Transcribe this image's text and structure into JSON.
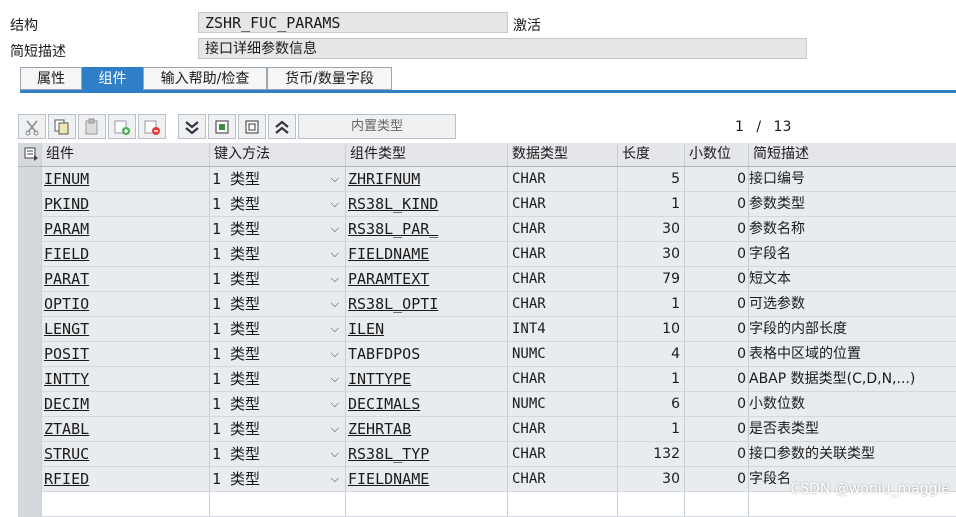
{
  "header": {
    "structure_label": "结构",
    "structure_value": "ZSHR_FUC_PARAMS",
    "status": "激活",
    "desc_label": "简短描述",
    "desc_value": "接口详细参数信息"
  },
  "tabs": [
    {
      "label": "属性",
      "active": false
    },
    {
      "label": "组件",
      "active": true
    },
    {
      "label": "输入帮助/检查",
      "active": false
    },
    {
      "label": "货币/数量字段",
      "active": false
    }
  ],
  "toolbar": {
    "builtin_type_label": "内置类型",
    "icons": [
      "cut-icon",
      "copy-icon",
      "paste-icon",
      "insert-row-icon",
      "delete-row-icon",
      "expand-icon",
      "new-icon",
      "edit-icon",
      "collapse-icon"
    ]
  },
  "pager": {
    "current": "1",
    "separator": "/",
    "total": "13"
  },
  "grid": {
    "columns": [
      "组件",
      "键入方法",
      "组件类型",
      "数据类型",
      "长度",
      "小数位",
      "简短描述"
    ],
    "rows": [
      {
        "component": "IFNUM",
        "method": "1 类型",
        "comp_type": "ZHRIFNUM",
        "data_type": "CHAR",
        "length": "5",
        "decimals": "0",
        "desc": "接口编号",
        "linked": true
      },
      {
        "component": "PKIND",
        "method": "1 类型",
        "comp_type": "RS38L_KIND",
        "data_type": "CHAR",
        "length": "1",
        "decimals": "0",
        "desc": "参数类型",
        "linked": true
      },
      {
        "component": "PARAM",
        "method": "1 类型",
        "comp_type": "RS38L_PAR_",
        "data_type": "CHAR",
        "length": "30",
        "decimals": "0",
        "desc": "参数名称",
        "linked": true
      },
      {
        "component": "FIELD",
        "method": "1 类型",
        "comp_type": "FIELDNAME",
        "data_type": "CHAR",
        "length": "30",
        "decimals": "0",
        "desc": "字段名",
        "linked": true
      },
      {
        "component": "PARAT",
        "method": "1 类型",
        "comp_type": "PARAMTEXT",
        "data_type": "CHAR",
        "length": "79",
        "decimals": "0",
        "desc": "短文本",
        "linked": true
      },
      {
        "component": "OPTIO",
        "method": "1 类型",
        "comp_type": "RS38L_OPTI",
        "data_type": "CHAR",
        "length": "1",
        "decimals": "0",
        "desc": "可选参数",
        "linked": true
      },
      {
        "component": "LENGT",
        "method": "1 类型",
        "comp_type": "ILEN",
        "data_type": "INT4",
        "length": "10",
        "decimals": "0",
        "desc": "字段的内部长度",
        "linked": true
      },
      {
        "component": "POSIT",
        "method": "1 类型",
        "comp_type": "TABFDPOS",
        "data_type": "NUMC",
        "length": "4",
        "decimals": "0",
        "desc": " 表格中区域的位置",
        "linked": false
      },
      {
        "component": "INTTY",
        "method": "1 类型",
        "comp_type": "INTTYPE",
        "data_type": "CHAR",
        "length": "1",
        "decimals": "0",
        "desc": "ABAP 数据类型(C,D,N,...)",
        "linked": true
      },
      {
        "component": "DECIM",
        "method": "1 类型",
        "comp_type": "DECIMALS",
        "data_type": "NUMC",
        "length": "6",
        "decimals": "0",
        "desc": "小数位数",
        "linked": true
      },
      {
        "component": "ZTABL",
        "method": "1 类型",
        "comp_type": "ZEHRTAB",
        "data_type": "CHAR",
        "length": "1",
        "decimals": "0",
        "desc": "是否表类型",
        "linked": true
      },
      {
        "component": "STRUC",
        "method": "1 类型",
        "comp_type": "RS38L_TYP",
        "data_type": "CHAR",
        "length": "132",
        "decimals": "0",
        "desc": "接口参数的关联类型",
        "linked": true
      },
      {
        "component": "RFIED",
        "method": "1 类型",
        "comp_type": "FIELDNAME",
        "data_type": "CHAR",
        "length": "30",
        "decimals": "0",
        "desc": "字段名",
        "linked": true
      }
    ]
  },
  "watermark": "CSDN @woniu_maggie"
}
